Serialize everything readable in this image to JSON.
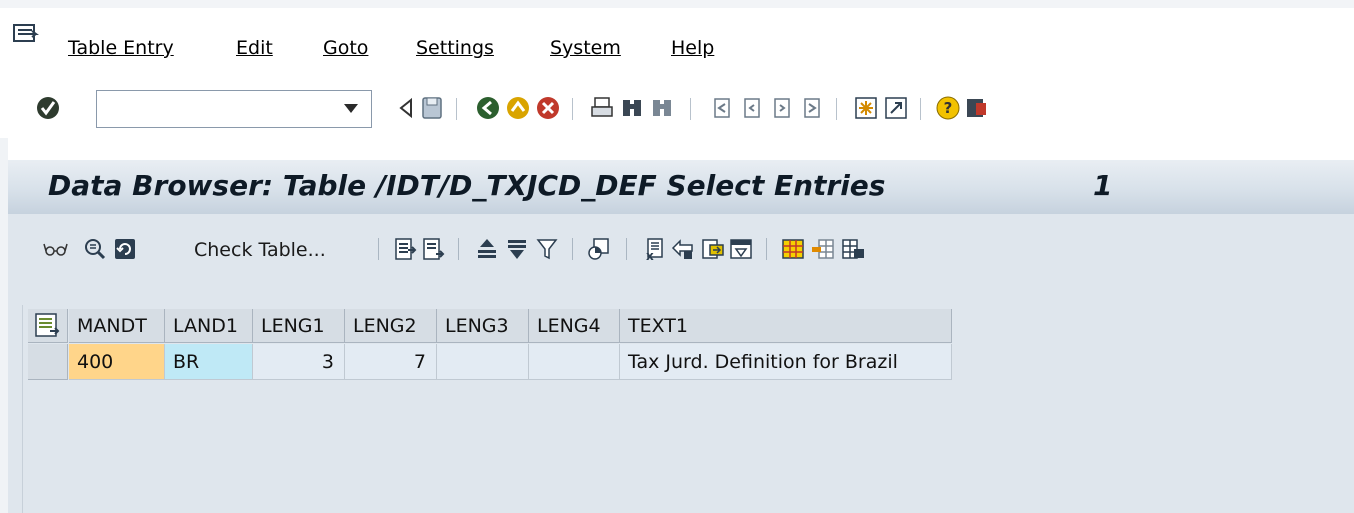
{
  "menubar": {
    "items": [
      "Table Entry",
      "Edit",
      "Goto",
      "Settings",
      "System",
      "Help"
    ]
  },
  "toolbar": {
    "command_field_value": "",
    "icons": [
      "enter-icon",
      "back-arrow-icon",
      "save-icon",
      "back-icon",
      "exit-icon",
      "cancel-icon",
      "print-icon",
      "find-icon",
      "find-next-icon",
      "first-page-icon",
      "previous-page-icon",
      "next-page-icon",
      "last-page-icon",
      "create-session-icon",
      "shortcut-icon",
      "help-icon",
      "customize-layout-icon"
    ]
  },
  "title": {
    "text": "Data Browser: Table /IDT/D_TXJCD_DEF Select Entries",
    "count": "1"
  },
  "app_toolbar": {
    "check_table_label": "Check Table...",
    "icons": [
      "glasses-icon",
      "details-icon",
      "refresh-icon",
      "select-all-icon",
      "deselect-all-icon",
      "sort-ascending-icon",
      "filter-icon",
      "set-filter-icon",
      "graphics-icon",
      "export-icon",
      "change-layout-icon",
      "print-preview-icon",
      "abc-analysis-icon",
      "spreadsheet-icon",
      "insert-row-icon",
      "delete-row-icon"
    ]
  },
  "grid": {
    "columns": [
      "MANDT",
      "LAND1",
      "LENG1",
      "LENG2",
      "LENG3",
      "LENG4",
      "TEXT1"
    ],
    "rows": [
      [
        "400",
        "BR",
        "3",
        "7",
        "",
        "",
        "Tax Jurd. Definition for Brazil"
      ]
    ]
  },
  "colors": {
    "key_cell_mandt": "#ffd58a",
    "key_cell_land1": "#bfe9f6",
    "data_cell": "#e3ebf3",
    "title_text": "#0e1a26"
  }
}
